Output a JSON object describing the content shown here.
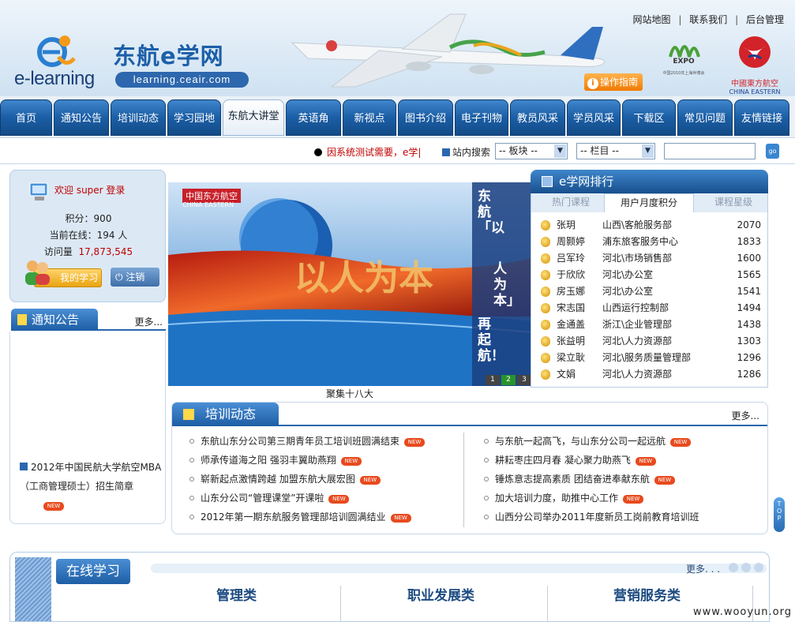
{
  "header": {
    "logo_brand": "e-learning",
    "logo_title": "东航e学网",
    "logo_url": "learning.ceair.com",
    "top_links": [
      "网站地图",
      "联系我们",
      "后台管理"
    ],
    "guide_button": "操作指南",
    "expo_text": "EXPO",
    "expo_caption": "中国2010年上海世博会",
    "airline_name_cn": "中國東方航空",
    "airline_name_en": "CHINA EASTERN"
  },
  "nav": {
    "items": [
      "首页",
      "通知公告",
      "培训动态",
      "学习园地",
      "东航大讲堂",
      "英语角",
      "新视点",
      "图书介绍",
      "电子刊物",
      "教员风采",
      "学员风采",
      "下载区",
      "常见问题",
      "友情链接"
    ],
    "active_index": 4
  },
  "searchbar": {
    "marquee": "因系统测试需要，e学|",
    "site_search_label": "站内搜索",
    "select_block": "-- 板块 --",
    "select_column": "-- 栏目 --",
    "go_label": "go"
  },
  "login": {
    "welcome": "欢迎 super 登录",
    "points_label": "积分：",
    "points": "900",
    "online_label": "当前在线：",
    "online": "194 人",
    "visits_label": "访问量",
    "visits": "17,873,545",
    "my_learning_button": "我的学习",
    "logout_button": "注销"
  },
  "notice": {
    "title": "通知公告",
    "more": "更多...",
    "items": [
      {
        "text": "2012年中国民航大学航空MBA（工商管理硕士）招生简章",
        "is_new": true
      }
    ]
  },
  "banner": {
    "airline_cn": "中国东方航空",
    "airline_en": "CHINA EASTERN",
    "vertical_text_1": "东航「以",
    "vertical_text_2": "人为本」",
    "vertical_text_3": "再起航！",
    "slogan_1": "以人为本",
    "caption": "聚集十八大",
    "pager": [
      "1",
      "2",
      "3"
    ],
    "pager_active": 1
  },
  "ranking": {
    "title": "e学网排行",
    "tabs": [
      "热门课程",
      "用户月度积分",
      "课程星级"
    ],
    "active_tab": 1,
    "rows": [
      {
        "name": "张玥",
        "dept": "山西\\客舱服务部",
        "score": "2070"
      },
      {
        "name": "周颢婷",
        "dept": "浦东旅客服务中心",
        "score": "1833"
      },
      {
        "name": "吕军玲",
        "dept": "河北\\市场销售部",
        "score": "1600"
      },
      {
        "name": "于欣欣",
        "dept": "河北\\办公室",
        "score": "1565"
      },
      {
        "name": "房玉娜",
        "dept": "河北\\办公室",
        "score": "1541"
      },
      {
        "name": "宋志国",
        "dept": "山西运行控制部",
        "score": "1494"
      },
      {
        "name": "金通盖",
        "dept": "浙江\\企业管理部",
        "score": "1438"
      },
      {
        "name": "张益明",
        "dept": "河北\\人力资源部",
        "score": "1303"
      },
      {
        "name": "梁立耿",
        "dept": "河北\\服务质量管理部",
        "score": "1296"
      },
      {
        "name": "文娟",
        "dept": "河北\\人力资源部",
        "score": "1286"
      }
    ]
  },
  "training": {
    "title": "培训动态",
    "more": "更多...",
    "left": [
      {
        "text": "东航山东分公司第三期青年员工培训班圆满结束",
        "is_new": true
      },
      {
        "text": "师承传道海之阳 强羽丰翼助燕翔",
        "is_new": true
      },
      {
        "text": "崭新起点激情跨越 加盟东航大展宏图",
        "is_new": true
      },
      {
        "text": "山东分公司“管理课堂”开课啦",
        "is_new": true
      },
      {
        "text": "2012年第一期东航服务管理部培训圆满结业",
        "is_new": true
      }
    ],
    "right": [
      {
        "text": "与东航一起高飞，与山东分公司一起远航",
        "is_new": true
      },
      {
        "text": "耕耘枣庄四月春 凝心聚力助燕飞",
        "is_new": true
      },
      {
        "text": "锤炼意志提高素质 团结奋进奉献东航",
        "is_new": true
      },
      {
        "text": "加大培训力度，助推中心工作",
        "is_new": true
      },
      {
        "text": "山西分公司举办2011年度新员工岗前教育培训班",
        "is_new": false
      }
    ],
    "new_label": "NEW"
  },
  "top_button": "TOP",
  "online": {
    "title": "在线学习",
    "more": "更多. . .",
    "categories": [
      "管理类",
      "职业发展类",
      "营销服务类"
    ]
  },
  "watermark": "www.wooyun.org"
}
